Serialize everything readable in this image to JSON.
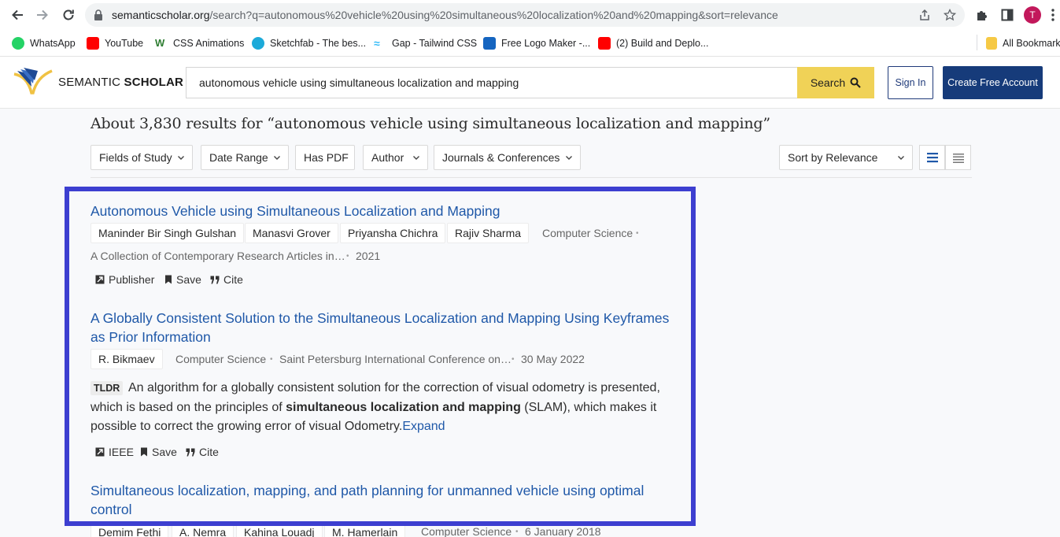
{
  "browser": {
    "url_host": "semanticscholar.org",
    "url_path": "/search?q=autonomous%20vehicle%20using%20simultaneous%20localization%20and%20mapping&sort=relevance",
    "avatar_letter": "T"
  },
  "bookmarks": [
    {
      "label": "WhatsApp",
      "color": "#25d366"
    },
    {
      "label": "YouTube",
      "color": "#ff0000"
    },
    {
      "label": "CSS Animations",
      "color": "#2e7d32"
    },
    {
      "label": "Sketchfab - The bes...",
      "color": "#1caad9"
    },
    {
      "label": "Gap - Tailwind CSS",
      "color": "#38bdf8"
    },
    {
      "label": "Free Logo Maker -...",
      "color": "#1565c0"
    },
    {
      "label": "(2) Build and Deplo...",
      "color": "#ff0000"
    },
    {
      "label": "All Bookmark",
      "color": "#f6c945"
    }
  ],
  "header": {
    "logo_semantic": "SEMANTIC",
    "logo_scholar": "SCHOLAR",
    "search_value": "autonomous vehicle using simultaneous localization and mapping",
    "search_button": "Search",
    "sign_in": "Sign In",
    "create_account": "Create Free Account"
  },
  "results": {
    "heading": "About 3,830 results for “autonomous vehicle using simultaneous localization and mapping”",
    "filters": [
      "Fields of Study",
      "Date Range",
      "Has PDF",
      "Author",
      "Journals & Conferences"
    ],
    "sort": "Sort by Relevance"
  },
  "papers": [
    {
      "title": "Autonomous Vehicle using Simultaneous Localization and Mapping",
      "authors": [
        "Maninder Bir Singh Gulshan",
        "Manasvi Grover",
        "Priyansha Chichra",
        "Rajiv Sharma"
      ],
      "field": "Computer Science",
      "venue": "A Collection of Contemporary Research Articles in…",
      "date": "2021",
      "actions": [
        "Publisher",
        "Save",
        "Cite"
      ]
    },
    {
      "title": "A Globally Consistent Solution to the Simultaneous Localization and Mapping Using Keyframes as Prior Information",
      "authors": [
        "R. Bikmaev"
      ],
      "field": "Computer Science",
      "venue": "Saint Petersburg International Conference on…",
      "date": "30 May 2022",
      "tldr_label": "TLDR",
      "tldr_before": "An algorithm for a globally consistent solution for the correction of visual odometry is presented, which is based on the principles of ",
      "tldr_bold": "simultaneous localization and mapping",
      "tldr_after": " (SLAM), which makes it possible to correct the growing error of visual Odometry.",
      "expand": "Expand",
      "actions": [
        "IEEE",
        "Save",
        "Cite"
      ]
    },
    {
      "title": "Simultaneous localization, mapping, and path planning for unmanned vehicle using optimal control",
      "authors": [
        "Demim Fethi",
        "A. Nemra",
        "Kahina Louadj",
        "M. Hamerlain"
      ],
      "field": "Computer Science",
      "date": "6 January 2018"
    }
  ]
}
